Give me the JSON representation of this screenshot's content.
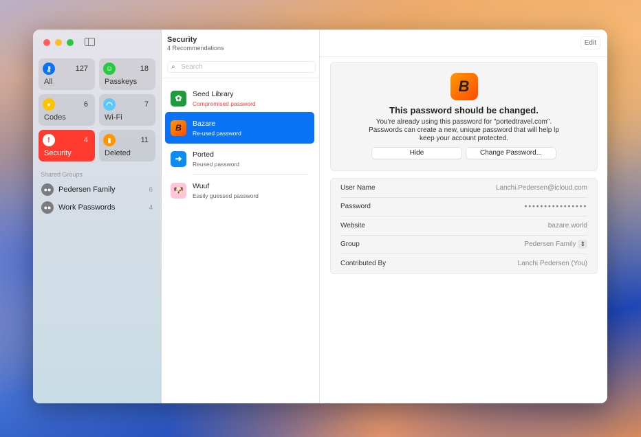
{
  "sidebar": {
    "tiles": [
      {
        "label": "All",
        "count": "127",
        "color": "#0a72f5",
        "glyph": "⚷",
        "icon": "key-icon"
      },
      {
        "label": "Passkeys",
        "count": "18",
        "color": "#28c840",
        "glyph": "☺",
        "icon": "passkey-icon"
      },
      {
        "label": "Codes",
        "count": "6",
        "color": "#ffc400",
        "glyph": "🔒",
        "icon": "lock-code-icon"
      },
      {
        "label": "Wi-Fi",
        "count": "7",
        "color": "#5ac8fa",
        "glyph": "◠",
        "icon": "wifi-icon"
      },
      {
        "label": "Security",
        "count": "4",
        "color": "#ffffff",
        "glyph": "!",
        "icon": "exclamation-icon"
      },
      {
        "label": "Deleted",
        "count": "11",
        "color": "#ff9500",
        "glyph": "🗑",
        "icon": "trash-icon"
      }
    ],
    "shared_groups_heading": "Shared Groups",
    "groups": [
      {
        "label": "Pedersen Family",
        "count": "6"
      },
      {
        "label": "Work Passwords",
        "count": "4"
      }
    ]
  },
  "list": {
    "title": "Security",
    "subtitle": "4 Recommendations",
    "search_placeholder": "Search",
    "items": [
      {
        "name": "Seed Library",
        "status": "Compromised password"
      },
      {
        "name": "Bazare",
        "status": "Re-used password"
      },
      {
        "name": "Ported",
        "status": "Reused password"
      },
      {
        "name": "Wuuf",
        "status": "Easily guessed password"
      }
    ]
  },
  "detail": {
    "edit_label": "Edit",
    "warning_title": "This password should be changed.",
    "warning_lines": [
      "You're already using this password for \"portedtravel.com\".",
      "Passwords can create a new, unique password that will help lp",
      "keep your account protected."
    ],
    "hide_label": "Hide",
    "change_label": "Change Password...",
    "fields": [
      {
        "label": "User Name",
        "value": "Lanchi.Pedersen@icloud.com"
      },
      {
        "label": "Password",
        "value": "●●●●●●●●●●●●●●●●"
      },
      {
        "label": "Website",
        "value": "bazare.world"
      },
      {
        "label": "Group",
        "value": "Pedersen Family"
      },
      {
        "label": "Contributed By",
        "value": "Lanchi Pedersen (You)"
      }
    ]
  }
}
